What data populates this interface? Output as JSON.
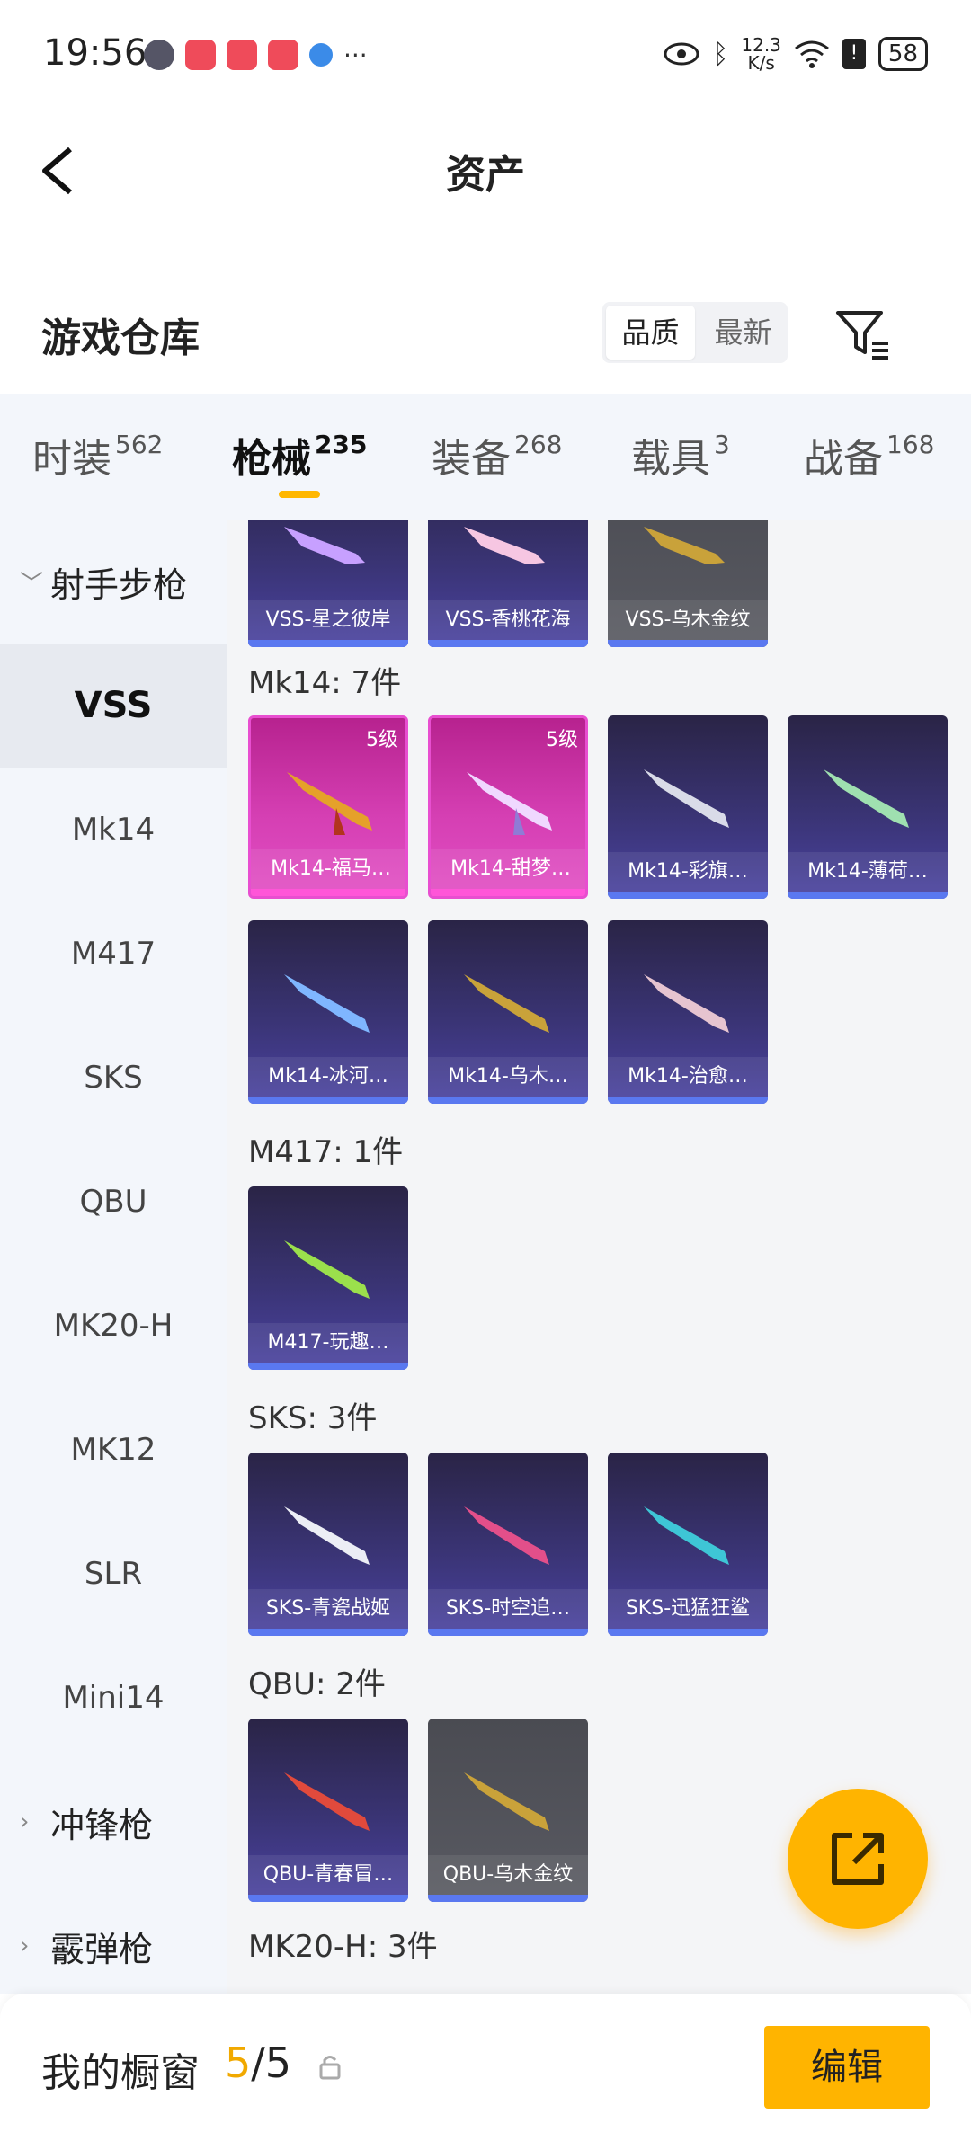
{
  "status_bar": {
    "time": "19:56",
    "net_speed_value": "12.3",
    "net_speed_unit": "K/s",
    "battery": "58"
  },
  "header": {
    "title": "资产"
  },
  "section": {
    "title": "游戏仓库",
    "sort_options": [
      "品质",
      "最新"
    ]
  },
  "tabs": [
    {
      "label": "时装",
      "count": "562"
    },
    {
      "label": "枪械",
      "count": "235"
    },
    {
      "label": "装备",
      "count": "268"
    },
    {
      "label": "载具",
      "count": "3"
    },
    {
      "label": "战备",
      "count": "168"
    }
  ],
  "sidebar": {
    "groups": [
      {
        "label": "射手步枪",
        "items": [
          "VSS",
          "Mk14",
          "M417",
          "SKS",
          "QBU",
          "MK20-H",
          "MK12",
          "SLR",
          "Mini14"
        ]
      },
      {
        "label": "冲锋枪"
      },
      {
        "label": "霰弹枪"
      }
    ]
  },
  "content": {
    "vss_items": [
      "VSS-星之彼岸",
      "VSS-香桃花海",
      "VSS-乌木金纹"
    ],
    "mk14_label": "Mk14: 7件",
    "mk14_items": [
      "Mk14-福马…",
      "Mk14-甜梦…",
      "Mk14-彩旗…",
      "Mk14-薄荷…",
      "Mk14-冰河…",
      "Mk14-乌木…",
      "Mk14-治愈…"
    ],
    "level_tag": "5级",
    "m417_label": "M417: 1件",
    "m417_items": [
      "M417-玩趣…"
    ],
    "sks_label": "SKS: 3件",
    "sks_items": [
      "SKS-青瓷战姬",
      "SKS-时空追…",
      "SKS-迅猛狂鲨"
    ],
    "qbu_label": "QBU: 2件",
    "qbu_items": [
      "QBU-青春冒…",
      "QBU-乌木金纹"
    ],
    "mk20_label": "MK20-H: 3件"
  },
  "bottom_bar": {
    "label": "我的橱窗",
    "current": "5",
    "sep_total": "/5",
    "edit": "编辑"
  },
  "colors": {
    "accent": "#ffb400",
    "legendary": "#e84ed0",
    "epic": "#3a3475"
  }
}
